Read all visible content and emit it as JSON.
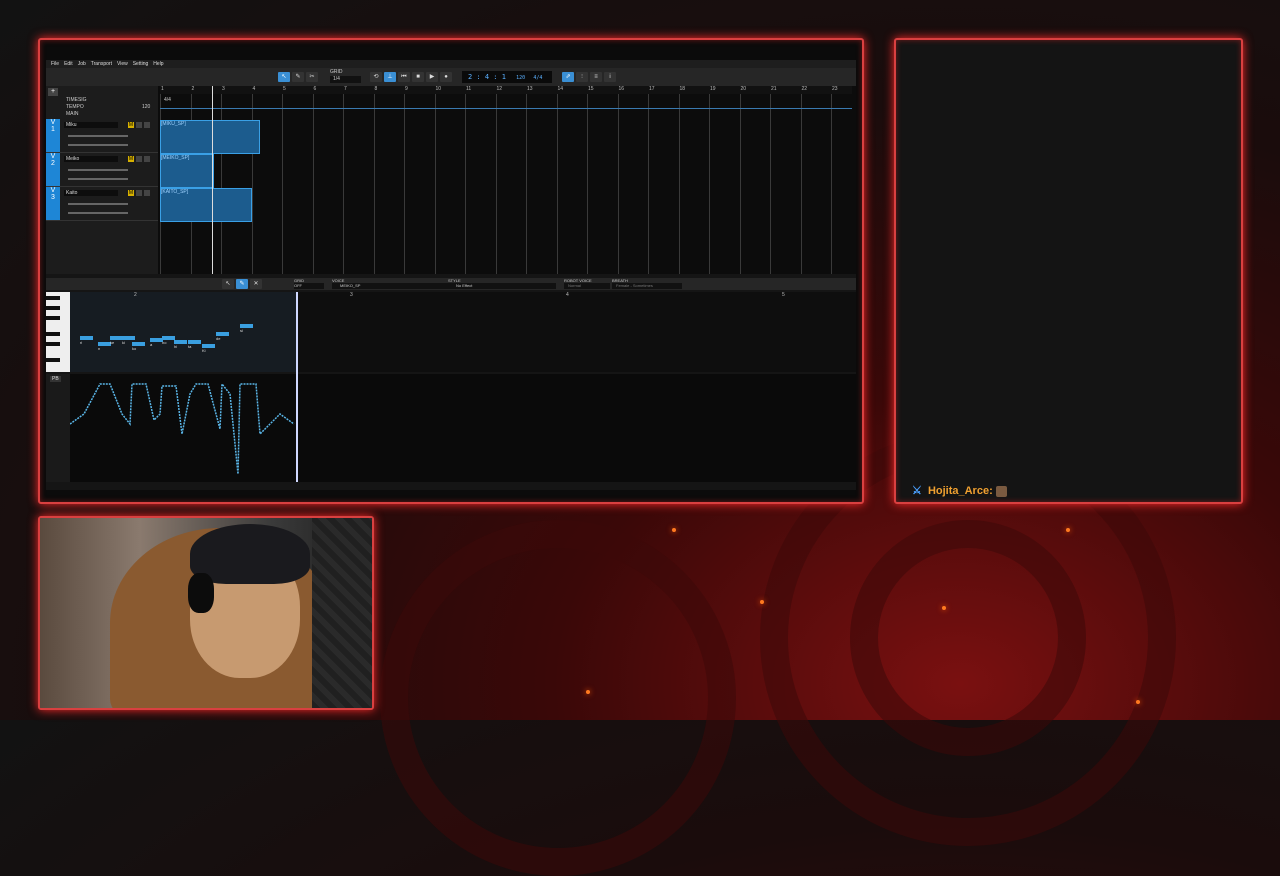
{
  "daw": {
    "menu": [
      "File",
      "Edit",
      "Job",
      "Transport",
      "View",
      "Setting",
      "Help"
    ],
    "grid_label": "GRID",
    "grid_value": "1/4",
    "counter": "2 : 4 : 1",
    "tempo": "120",
    "timesig": "4/4",
    "lanes": {
      "timesig": "TIMESIG",
      "tempo": "TEMPO",
      "main": "MAIN"
    },
    "tempo_value": "120",
    "timesig_value": "4/4",
    "tracks": [
      {
        "num": "1",
        "name": "Miku",
        "part": "[MIKU_SP]"
      },
      {
        "num": "2",
        "name": "Meiko",
        "part": "[MEIKO_SP]"
      },
      {
        "num": "3",
        "name": "Kaito",
        "part": "[KAITO_SP]"
      }
    ],
    "bars": [
      "1",
      "2",
      "3",
      "4",
      "5",
      "6",
      "7",
      "8",
      "9",
      "10",
      "11",
      "12",
      "13",
      "14",
      "15",
      "16",
      "17",
      "18",
      "19",
      "20",
      "21",
      "22",
      "23"
    ],
    "lower": {
      "grid_label": "GRID",
      "grid_value": "OFF",
      "voice_label": "VOICE",
      "voice_value": "MEIKO_SP",
      "style_label": "STYLE",
      "style_value": "No Effect",
      "robot_label": "ROBOT VOICE",
      "robot_value": "Normal",
      "breath_label": "BREATH",
      "breath_value": "Female - Sometimes",
      "pb_label": "PB",
      "roll_bars": [
        "2",
        "3",
        "4",
        "5"
      ],
      "notes": [
        "ri",
        "n",
        "ke",
        "ki",
        "ko",
        "a",
        "no",
        "hi",
        "ta",
        "Ki",
        "de",
        "si"
      ]
    }
  },
  "chat": {
    "user": "Hojita_Arce:"
  },
  "colors": {
    "frame": "#d94040",
    "accent": "#3a8fd4",
    "part": "#1c5c8e"
  }
}
